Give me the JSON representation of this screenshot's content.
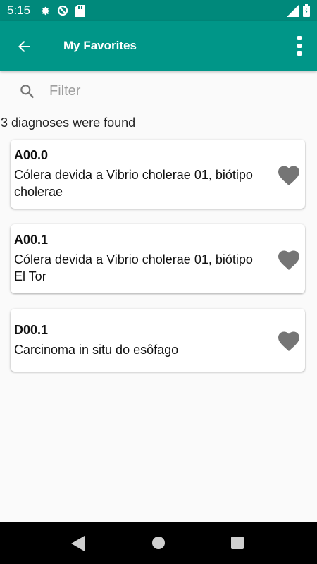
{
  "status_bar": {
    "time": "5:15",
    "icons_left": [
      "settings-icon",
      "data-saver-icon",
      "sd-card-icon"
    ],
    "icons_right": [
      "signal-icon",
      "battery-icon"
    ]
  },
  "app_bar": {
    "title": "My Favorites",
    "back_icon": "arrow-back-icon",
    "menu_icon": "more-vert-icon",
    "color": "#009688"
  },
  "filter": {
    "placeholder": "Filter",
    "value": ""
  },
  "result_count": "3 diagnoses were found",
  "diagnoses": [
    {
      "code": "A00.0",
      "description": "Cólera devida a Vibrio cholerae 01, biótipo cholerae",
      "favorite": true
    },
    {
      "code": "A00.1",
      "description": "Cólera devida a Vibrio cholerae 01, biótipo El Tor",
      "favorite": true
    },
    {
      "code": "D00.1",
      "description": "Carcinoma in situ do esôfago",
      "favorite": true
    }
  ],
  "nav_bar": {
    "back_icon": "nav-back-icon",
    "home_icon": "nav-home-icon",
    "recents_icon": "nav-recents-icon"
  }
}
